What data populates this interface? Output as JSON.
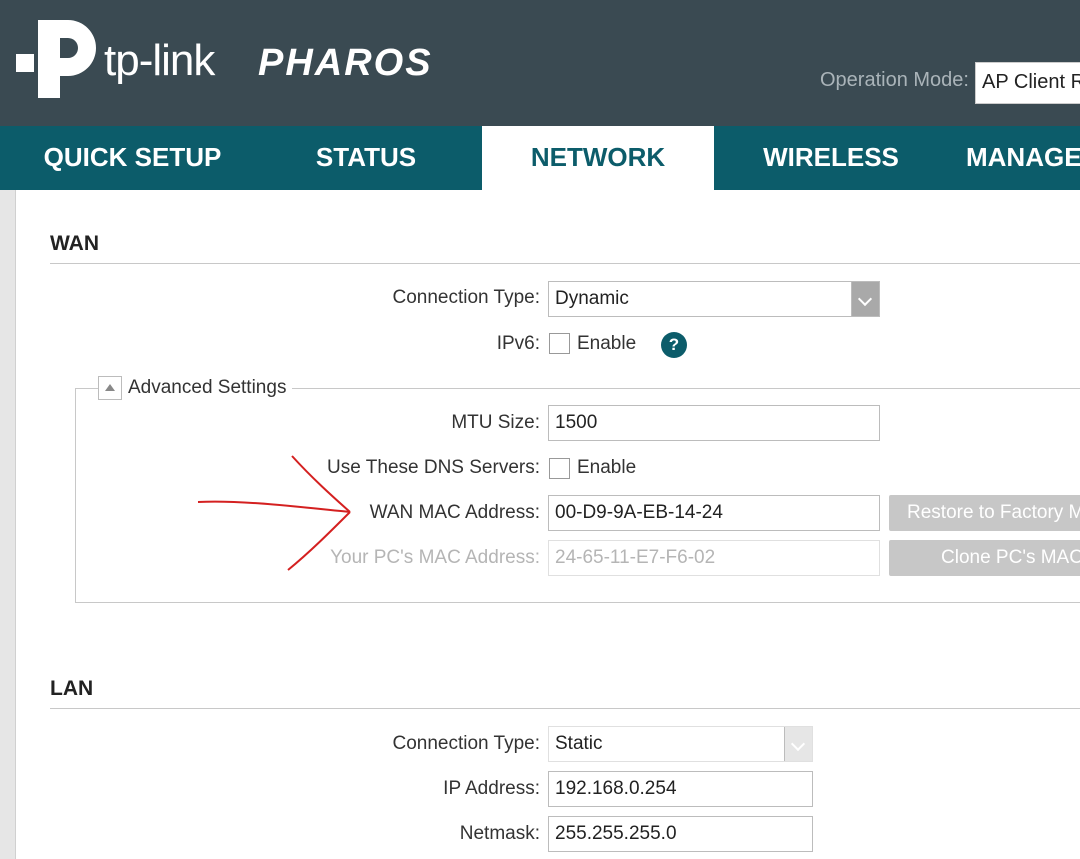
{
  "header": {
    "logo_text": "tp-link",
    "brand_text": "PHAROS",
    "operation_mode_label": "Operation Mode:",
    "operation_mode_value": "AP Client R"
  },
  "nav": {
    "tabs": [
      {
        "label": "QUICK SETUP",
        "active": false
      },
      {
        "label": "STATUS",
        "active": false
      },
      {
        "label": "NETWORK",
        "active": true
      },
      {
        "label": "WIRELESS",
        "active": false
      },
      {
        "label": "MANAGE",
        "active": false
      }
    ]
  },
  "wan": {
    "title": "WAN",
    "connection_type_label": "Connection Type:",
    "connection_type_value": "Dynamic",
    "ipv6_label": "IPv6:",
    "ipv6_enable_label": "Enable",
    "ipv6_enabled": false,
    "help_icon_glyph": "?",
    "advanced": {
      "legend": "Advanced Settings",
      "mtu_label": "MTU Size:",
      "mtu_value": "1500",
      "dns_label": "Use These DNS Servers:",
      "dns_enable_label": "Enable",
      "dns_enabled": false,
      "wan_mac_label": "WAN MAC Address:",
      "wan_mac_value": "00-D9-9A-EB-14-24",
      "restore_button": "Restore to Factory M",
      "pc_mac_label": "Your PC's MAC Address:",
      "pc_mac_value": "24-65-11-E7-F6-02",
      "clone_button": "Clone PC's MAC"
    }
  },
  "lan": {
    "title": "LAN",
    "connection_type_label": "Connection Type:",
    "connection_type_value": "Static",
    "ip_label": "IP Address:",
    "ip_value": "192.168.0.254",
    "netmask_label": "Netmask:",
    "netmask_value": "255.255.255.0"
  },
  "colors": {
    "header_bg": "#3a4a52",
    "nav_bg": "#0c5c6a",
    "annotation": "#d42020"
  }
}
